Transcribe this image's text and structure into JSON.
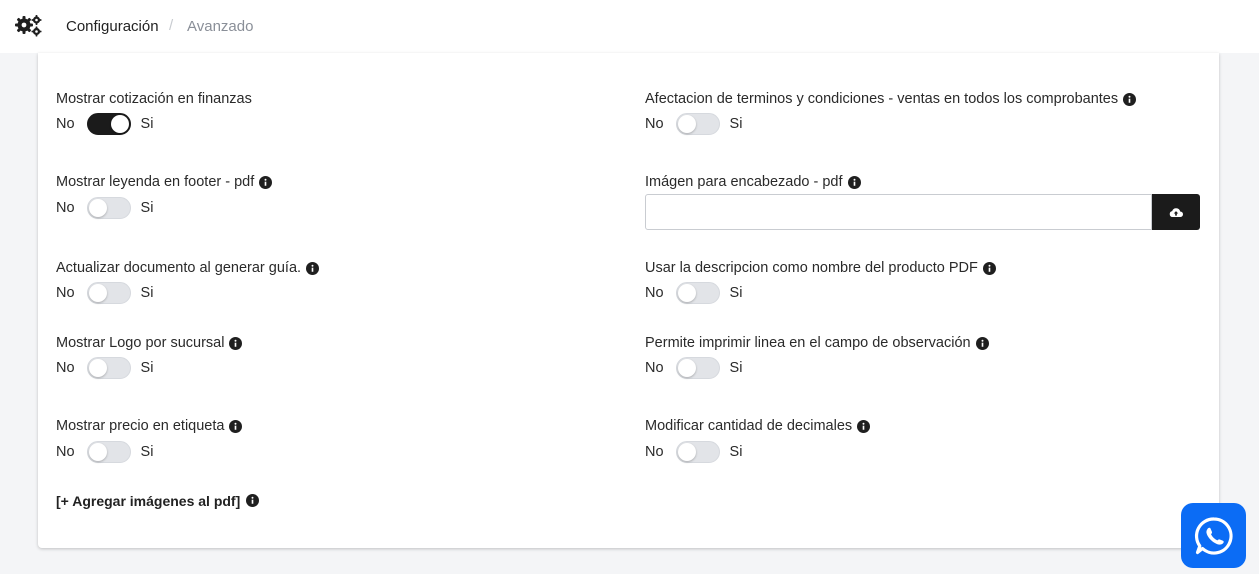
{
  "breadcrumb": {
    "current": "Configuración",
    "separator": "/",
    "link": "Avanzado"
  },
  "toggle_text": {
    "off": "No",
    "on": "Si"
  },
  "settings": [
    {
      "label": "Mostrar cotización en finanzas",
      "info": false,
      "enabled": true
    },
    {
      "label": "Afectacion de terminos y condiciones - ventas en todos los comprobantes",
      "info": true,
      "enabled": false
    },
    {
      "label": "Mostrar leyenda en footer - pdf",
      "info": true,
      "enabled": false
    },
    {
      "label": "Imágen para encabezado - pdf",
      "info": true
    },
    {
      "label": "Actualizar documento al generar guía.",
      "info": true,
      "enabled": false
    },
    {
      "label": "Usar la descripcion como nombre del producto PDF",
      "info": true,
      "enabled": false
    },
    {
      "label": "Mostrar Logo por sucursal",
      "info": true,
      "enabled": false
    },
    {
      "label": "Permite imprimir linea en el campo de observación",
      "info": true,
      "enabled": false
    },
    {
      "label": "Mostrar precio en etiqueta",
      "info": true,
      "enabled": false
    },
    {
      "label": "Modificar cantidad de decimales",
      "info": true,
      "enabled": false
    }
  ],
  "add_images_link": "[+ Agregar imágenes al pdf]",
  "icons": {
    "header": "gears-icon",
    "info": "info-circle-icon",
    "upload": "cloud-upload-icon",
    "chat": "whatsapp-icon"
  },
  "colors": {
    "toggle_on": "#1b1b1b",
    "toggle_off": "#e2e4e8",
    "chat_button": "#0b6cf5"
  }
}
